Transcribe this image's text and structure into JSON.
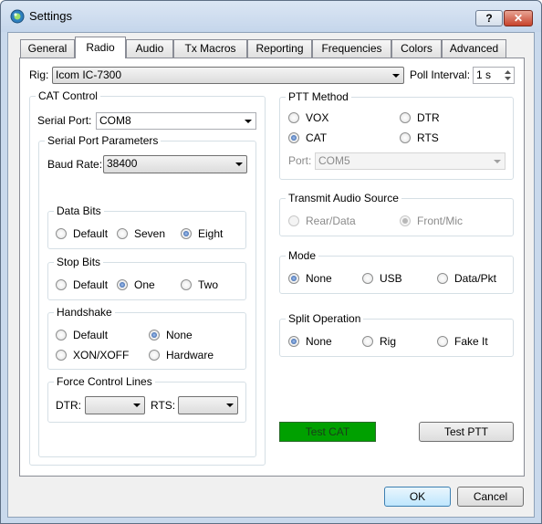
{
  "window": {
    "title": "Settings",
    "help_icon": "?",
    "close_icon": "✕"
  },
  "tabs": [
    "General",
    "Radio",
    "Audio",
    "Tx Macros",
    "Reporting",
    "Frequencies",
    "Colors",
    "Advanced"
  ],
  "rig": {
    "label": "Rig:",
    "value": "Icom IC-7300"
  },
  "poll": {
    "label": "Poll Interval:",
    "value": "1 s"
  },
  "cat": {
    "title": "CAT Control",
    "serial_port_label": "Serial Port:",
    "serial_port_value": "COM8",
    "params_title": "Serial Port Parameters",
    "baud_label": "Baud Rate:",
    "baud_value": "38400",
    "data_bits": {
      "title": "Data Bits",
      "options": [
        "Default",
        "Seven",
        "Eight"
      ],
      "selected": "Eight"
    },
    "stop_bits": {
      "title": "Stop Bits",
      "options": [
        "Default",
        "One",
        "Two"
      ],
      "selected": "One"
    },
    "handshake": {
      "title": "Handshake",
      "options": [
        "Default",
        "None",
        "XON/XOFF",
        "Hardware"
      ],
      "selected": "None"
    },
    "force": {
      "title": "Force Control Lines",
      "dtr_label": "DTR:",
      "dtr_value": "",
      "rts_label": "RTS:",
      "rts_value": ""
    }
  },
  "ptt": {
    "title": "PTT Method",
    "options": [
      "VOX",
      "DTR",
      "CAT",
      "RTS"
    ],
    "selected": "CAT",
    "port_label": "Port:",
    "port_value": "COM5"
  },
  "audio_source": {
    "title": "Transmit Audio Source",
    "options": [
      "Rear/Data",
      "Front/Mic"
    ],
    "selected": "Front/Mic"
  },
  "mode": {
    "title": "Mode",
    "options": [
      "None",
      "USB",
      "Data/Pkt"
    ],
    "selected": "None"
  },
  "split": {
    "title": "Split Operation",
    "options": [
      "None",
      "Rig",
      "Fake It"
    ],
    "selected": "None"
  },
  "buttons": {
    "test_cat": "Test CAT",
    "test_ptt": "Test PTT",
    "ok": "OK",
    "cancel": "Cancel"
  },
  "colors": {
    "test_cat_bg": "#00a000",
    "accent": "#1c4e9a"
  }
}
